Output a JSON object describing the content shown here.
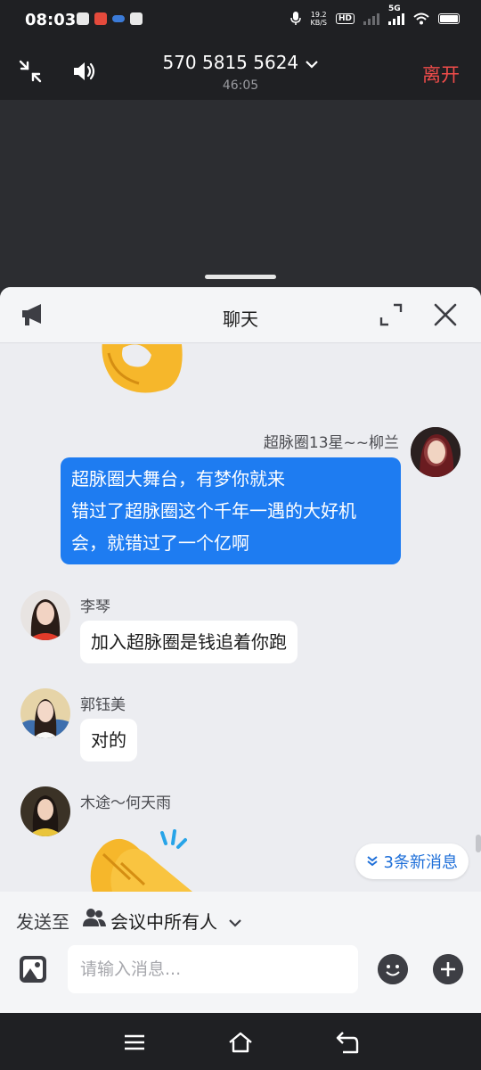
{
  "status_bar": {
    "time": "08:03",
    "speed_value": "19.2",
    "speed_unit": "KB/S",
    "hd_label": "HD",
    "network_label": "5G"
  },
  "meeting": {
    "number": "570 5815 5624",
    "timer": "46:05",
    "leave_label": "离开"
  },
  "chat": {
    "title": "聊天",
    "messages": [
      {
        "sender": "超脉圈13星~~柳兰",
        "text_line1": "超脉圈大舞台，有梦你就来",
        "text_line2": "错过了超脉圈这个千年一遇的大好机",
        "text_line3": "会，就错过了一个亿啊",
        "direction": "outgoing"
      },
      {
        "sender": "李琴",
        "text": "加入超脉圈是钱追着你跑",
        "direction": "incoming"
      },
      {
        "sender": "郭钰美",
        "text": "对的",
        "direction": "incoming"
      },
      {
        "sender": "木途～何天雨",
        "content": "clapping-hands-emoji",
        "direction": "incoming"
      }
    ],
    "new_messages_label": "3条新消息",
    "send_to_label": "发送至",
    "send_to_target": "会议中所有人",
    "input_placeholder": "请输入消息..."
  },
  "colors": {
    "accent_blue": "#1e7cf1",
    "leave_red": "#f04c4a",
    "dark_bg": "#1f2023"
  },
  "icons": [
    "minimize-icon",
    "speaker-icon",
    "chevron-down-icon",
    "megaphone-icon",
    "fullscreen-icon",
    "close-icon",
    "image-icon",
    "emoji-icon",
    "add-icon",
    "menu-icon",
    "home-icon",
    "back-icon"
  ]
}
